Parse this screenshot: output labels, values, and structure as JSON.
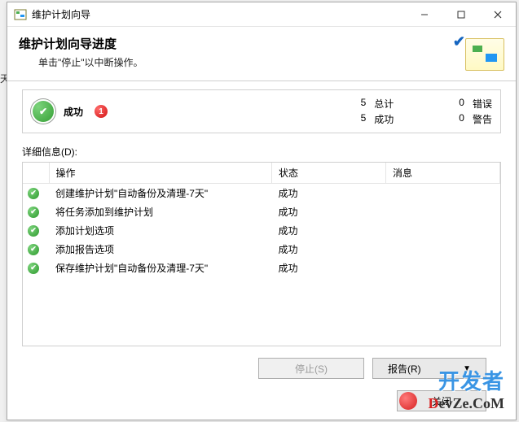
{
  "titlebar": {
    "title": "维护计划向导"
  },
  "header": {
    "title": "维护计划向导进度",
    "subtitle": "单击\"停止\"以中断操作。"
  },
  "summary": {
    "status_label": "成功",
    "badge": "1",
    "total_count": "5",
    "total_label": "总计",
    "success_count": "5",
    "success_label": "成功",
    "error_count": "0",
    "error_label": "错误",
    "warning_count": "0",
    "warning_label": "警告"
  },
  "detail_label": "详细信息(D):",
  "columns": {
    "action": "操作",
    "status": "状态",
    "message": "消息"
  },
  "rows": [
    {
      "action": "创建维护计划\"自动备份及清理-7天\"",
      "status": "成功",
      "message": ""
    },
    {
      "action": "将任务添加到维护计划",
      "status": "成功",
      "message": ""
    },
    {
      "action": "添加计划选项",
      "status": "成功",
      "message": ""
    },
    {
      "action": "添加报告选项",
      "status": "成功",
      "message": ""
    },
    {
      "action": "保存维护计划\"自动备份及清理-7天\"",
      "status": "成功",
      "message": ""
    }
  ],
  "buttons": {
    "stop": "停止(S)",
    "report": "报告(R)",
    "close": "关闭"
  },
  "watermark": {
    "line1": "开发者",
    "line2_d": "D",
    "line2_rest": "evZe.CoM"
  }
}
